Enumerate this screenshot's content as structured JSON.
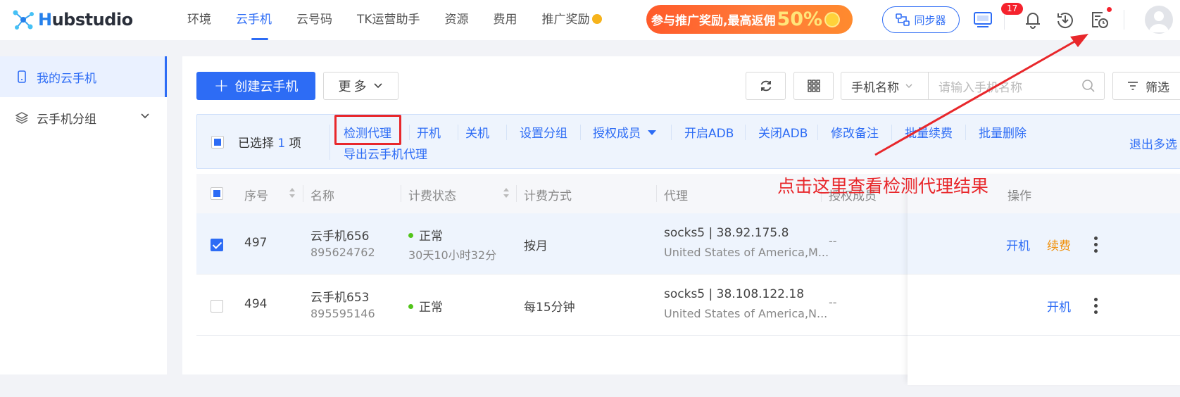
{
  "app": {
    "logo_text_h": "H",
    "logo_text_rest": "ubstudio"
  },
  "nav": {
    "items": [
      {
        "label": "环境",
        "active": false
      },
      {
        "label": "云手机",
        "active": true
      },
      {
        "label": "云号码",
        "active": false
      },
      {
        "label": "TK运营助手",
        "active": false
      },
      {
        "label": "资源",
        "active": false
      },
      {
        "label": "费用",
        "active": false
      },
      {
        "label": "推广奖励",
        "active": false
      }
    ]
  },
  "promo": {
    "text": "参与推广奖励,最高返佣",
    "percent": "50%"
  },
  "header": {
    "sync_label": "同步器",
    "notification_count": "17"
  },
  "sidebar": {
    "items": [
      {
        "label": "我的云手机",
        "active": true
      },
      {
        "label": "云手机分组",
        "active": false
      }
    ]
  },
  "toolbar": {
    "create_label": "创建云手机",
    "more_label": "更多",
    "search_select": "手机名称",
    "search_placeholder": "请输入手机名称",
    "filter_label": "筛选"
  },
  "selection_bar": {
    "selected_prefix": "已选择",
    "selected_count": "1",
    "selected_suffix": "项",
    "actions": [
      "检测代理",
      "开机",
      "关机",
      "设置分组",
      "授权成员",
      "开启ADB",
      "关闭ADB",
      "修改备注",
      "批量续费",
      "批量删除"
    ],
    "export_label": "导出云手机代理",
    "exit_label": "退出多选"
  },
  "table": {
    "columns": [
      "序号",
      "名称",
      "计费状态",
      "计费方式",
      "代理",
      "授权成员",
      "操作"
    ],
    "rows": [
      {
        "selected": true,
        "index": "497",
        "name": "云手机656",
        "id": "895624762",
        "status": "正常",
        "status_detail": "30天10小时32分",
        "billing": "按月",
        "proxy": "socks5 | 38.92.175.8",
        "proxy_location": "United States of America,M...",
        "members": "--",
        "ops": [
          "开机",
          "续费"
        ]
      },
      {
        "selected": false,
        "index": "494",
        "name": "云手机653",
        "id": "895595146",
        "status": "正常",
        "status_detail": "",
        "billing": "每15分钟",
        "proxy": "socks5 | 38.108.122.18",
        "proxy_location": "United States of America,N...",
        "members": "--",
        "ops": [
          "开机"
        ]
      }
    ]
  },
  "annotation": {
    "text": "点击这里查看检测代理结果",
    "color": "#e8272b"
  },
  "colors": {
    "accent": "#2d6cf5",
    "success": "#52c41a",
    "warning": "#f0900a"
  }
}
